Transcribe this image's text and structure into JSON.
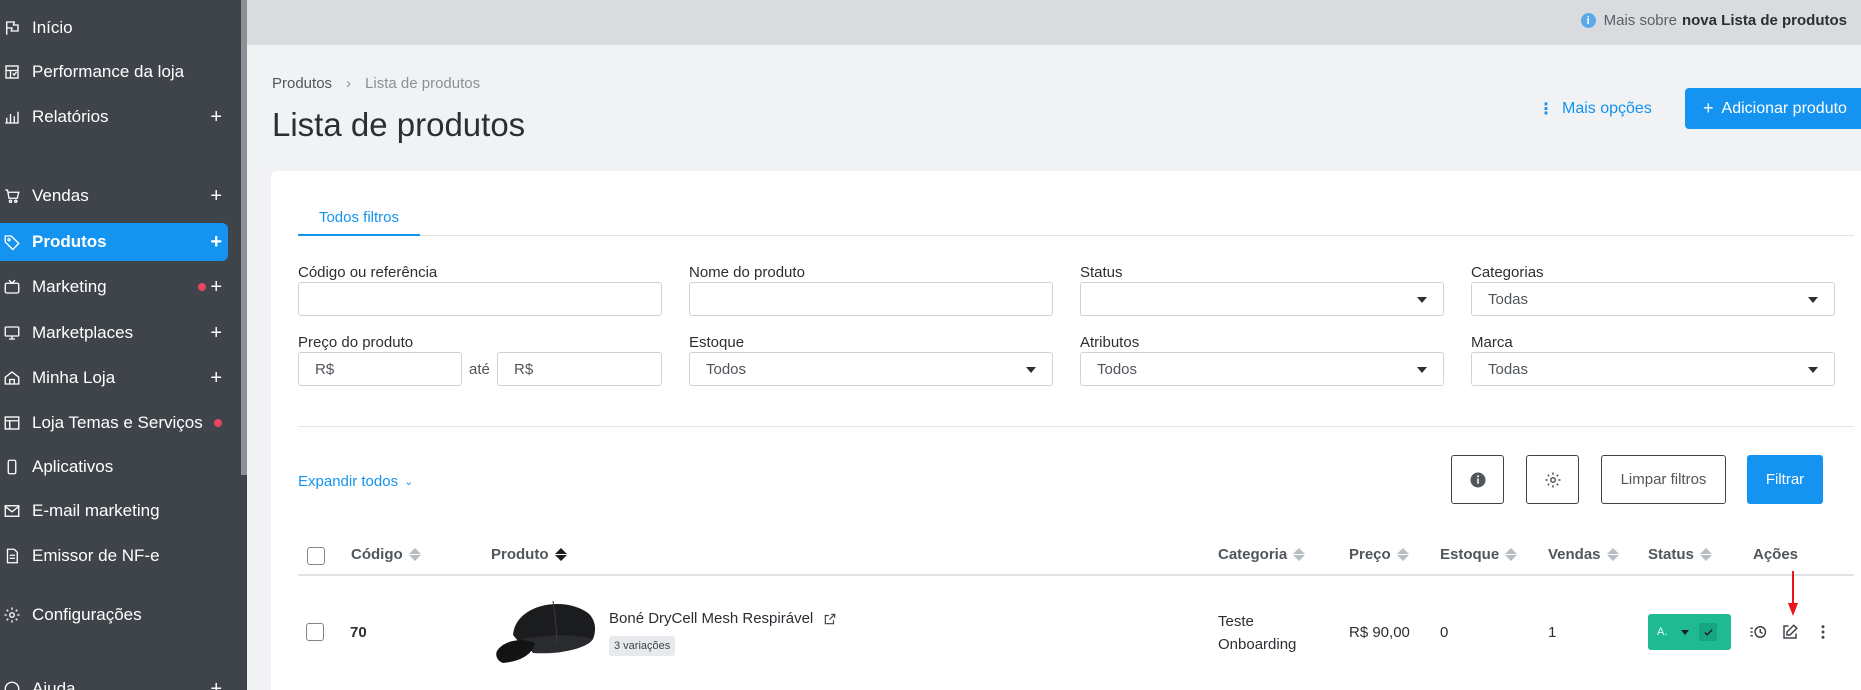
{
  "sidebar": {
    "items": [
      {
        "label": "Início",
        "icon": "flag-icon",
        "plus": false,
        "dot": false
      },
      {
        "label": "Performance da loja",
        "icon": "dashboard-icon",
        "plus": false,
        "dot": false
      },
      {
        "label": "Relatórios",
        "icon": "bar-chart-icon",
        "plus": true,
        "dot": false
      },
      {
        "label": "Vendas",
        "icon": "cart-icon",
        "plus": true,
        "dot": false
      },
      {
        "label": "Produtos",
        "icon": "tag-icon",
        "plus": true,
        "dot": false,
        "active": true
      },
      {
        "label": "Marketing",
        "icon": "tv-icon",
        "plus": true,
        "dot": true
      },
      {
        "label": "Marketplaces",
        "icon": "monitor-icon",
        "plus": true,
        "dot": false
      },
      {
        "label": "Minha Loja",
        "icon": "home-icon",
        "plus": true,
        "dot": false
      },
      {
        "label": "Loja Temas e Serviços",
        "icon": "layout-icon",
        "plus": false,
        "dot": true
      },
      {
        "label": "Aplicativos",
        "icon": "phone-icon",
        "plus": false,
        "dot": false
      },
      {
        "label": "E-mail marketing",
        "icon": "mail-icon",
        "plus": false,
        "dot": false
      },
      {
        "label": "Emissor de NF-e",
        "icon": "document-icon",
        "plus": false,
        "dot": false
      },
      {
        "label": "Configurações",
        "icon": "gear-icon",
        "plus": false,
        "dot": false
      },
      {
        "label": "Ajuda",
        "icon": "help-icon",
        "plus": true,
        "dot": false
      }
    ]
  },
  "topbar": {
    "info_prefix": "Mais sobre",
    "info_bold": "nova Lista de produtos"
  },
  "header": {
    "breadcrumb_root": "Produtos",
    "breadcrumb_sep": "›",
    "breadcrumb_current": "Lista de produtos",
    "title": "Lista de produtos",
    "more_options": "Mais opções",
    "add_product": "Adicionar produto"
  },
  "filters": {
    "tab": "Todos filtros",
    "code_label": "Código ou referência",
    "name_label": "Nome do produto",
    "status_label": "Status",
    "categories_label": "Categorias",
    "categories_value": "Todas",
    "price_label": "Preço do produto",
    "price_from_prefix": "R$",
    "price_between": "até",
    "price_to_prefix": "R$",
    "stock_label": "Estoque",
    "stock_value": "Todos",
    "attributes_label": "Atributos",
    "attributes_value": "Todos",
    "brand_label": "Marca",
    "brand_value": "Todas",
    "expand_all": "Expandir todos",
    "clear_filters": "Limpar filtros",
    "filter": "Filtrar"
  },
  "table": {
    "columns": {
      "code": "Código",
      "product": "Produto",
      "category": "Categoria",
      "price": "Preço",
      "stock": "Estoque",
      "sales": "Vendas",
      "status": "Status",
      "actions": "Ações"
    },
    "rows": [
      {
        "code": "70",
        "product": "Boné DryCell Mesh Respirável",
        "variations": "3 variações",
        "category_line1": "Teste",
        "category_line2": "Onboarding",
        "price": "R$ 90,00",
        "stock": "0",
        "sales": "1",
        "status": "A."
      }
    ]
  },
  "colors": {
    "primary": "#1493f0",
    "sidebar": "#3e444a",
    "status_green": "#1fb992",
    "alert_dot": "#e5485f",
    "arrow_red": "#e8151b"
  }
}
